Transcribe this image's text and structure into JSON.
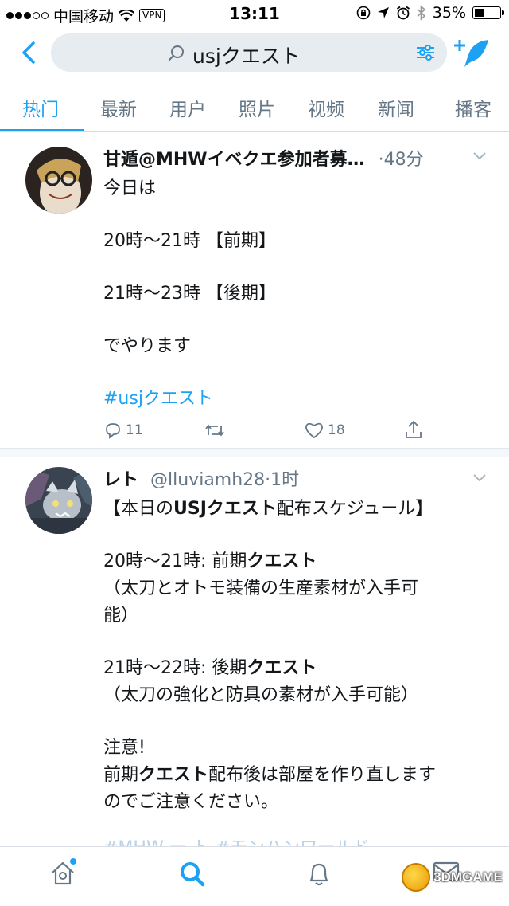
{
  "status_bar": {
    "carrier": "中国移动",
    "vpn": "VPN",
    "time": "13:11",
    "battery": "35%",
    "battery_level": 0.35
  },
  "search": {
    "query": "usjクエスト"
  },
  "tabs": [
    {
      "label": "热门",
      "active": true
    },
    {
      "label": "最新",
      "active": false
    },
    {
      "label": "用户",
      "active": false
    },
    {
      "label": "照片",
      "active": false
    },
    {
      "label": "视频",
      "active": false
    },
    {
      "label": "新闻",
      "active": false
    },
    {
      "label": "播客",
      "active": false
    }
  ],
  "tweets": [
    {
      "author": "甘遁@MHWイベクエ参加者募…",
      "time": "·48分",
      "lines": [
        "今日は",
        "20時～21時 【前期】",
        "21時～23時 【後期】",
        "でやります"
      ],
      "hashtag": "#usjクエスト",
      "replies": "11",
      "likes": "18"
    },
    {
      "author": "レト",
      "handle": "@lluviamh28",
      "time": "·1时",
      "l1_a": "【本日の",
      "l1_b": "USJクエスト",
      "l1_c": "配布スケジュール】",
      "l2_a": "20時～21時:  前期",
      "l2_b": "クエスト",
      "l3": "（太刀とオトモ装備の生産素材が入手可",
      "l4": "能）",
      "l5_a": "21時～22時:  後期",
      "l5_b": "クエスト",
      "l6": "（太刀の強化と防具の素材が入手可能）",
      "l7": "注意!",
      "l8_a": "前期",
      "l8_b": "クエスト",
      "l8_c": "配布後は部屋を作り直します",
      "l9": "のでご注意ください。",
      "l10": "#MHW  ー  ト  #モンハンワールド"
    }
  ],
  "watermark": "3DMGAME",
  "colors": {
    "accent": "#1da1f2",
    "text": "#14171a",
    "muted": "#657786"
  }
}
